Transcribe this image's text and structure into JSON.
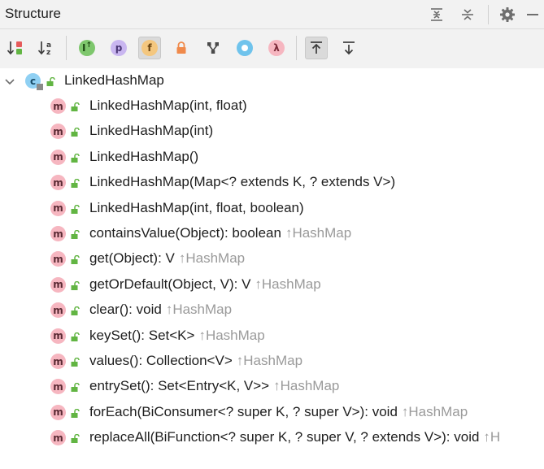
{
  "panel": {
    "title": "Structure"
  },
  "tree": {
    "root": {
      "label": "LinkedHashMap",
      "kind": "class"
    },
    "members": [
      {
        "label": "LinkedHashMap(int, float)",
        "inherited": ""
      },
      {
        "label": "LinkedHashMap(int)",
        "inherited": ""
      },
      {
        "label": "LinkedHashMap()",
        "inherited": ""
      },
      {
        "label": "LinkedHashMap(Map<? extends K, ? extends V>)",
        "inherited": ""
      },
      {
        "label": "LinkedHashMap(int, float, boolean)",
        "inherited": ""
      },
      {
        "label": "containsValue(Object): boolean",
        "inherited": "↑HashMap"
      },
      {
        "label": "get(Object): V",
        "inherited": "↑HashMap"
      },
      {
        "label": "getOrDefault(Object, V): V",
        "inherited": "↑HashMap"
      },
      {
        "label": "clear(): void",
        "inherited": "↑HashMap"
      },
      {
        "label": "keySet(): Set<K>",
        "inherited": "↑HashMap"
      },
      {
        "label": "values(): Collection<V>",
        "inherited": "↑HashMap"
      },
      {
        "label": "entrySet(): Set<Entry<K, V>>",
        "inherited": "↑HashMap"
      },
      {
        "label": "forEach(BiConsumer<? super K, ? super V>): void",
        "inherited": "↑HashMap"
      },
      {
        "label": "replaceAll(BiFunction<? super K, ? super V, ? extends V>): void",
        "inherited": "↑H"
      }
    ],
    "member_badge": "m",
    "class_badge": "c"
  },
  "toolbar": {
    "sort_alpha_badge": "a",
    "show_inherited_badge": "I",
    "show_properties_badge": "p",
    "show_fields_badge": "f",
    "show_lambdas_badge": "λ"
  },
  "colors": {
    "method_badge": "#f6b6c0",
    "class_badge": "#8fd0f3",
    "lock_green": "#62b543",
    "inherited_gray": "#9a9a9a",
    "fields_active": "#dadada"
  }
}
